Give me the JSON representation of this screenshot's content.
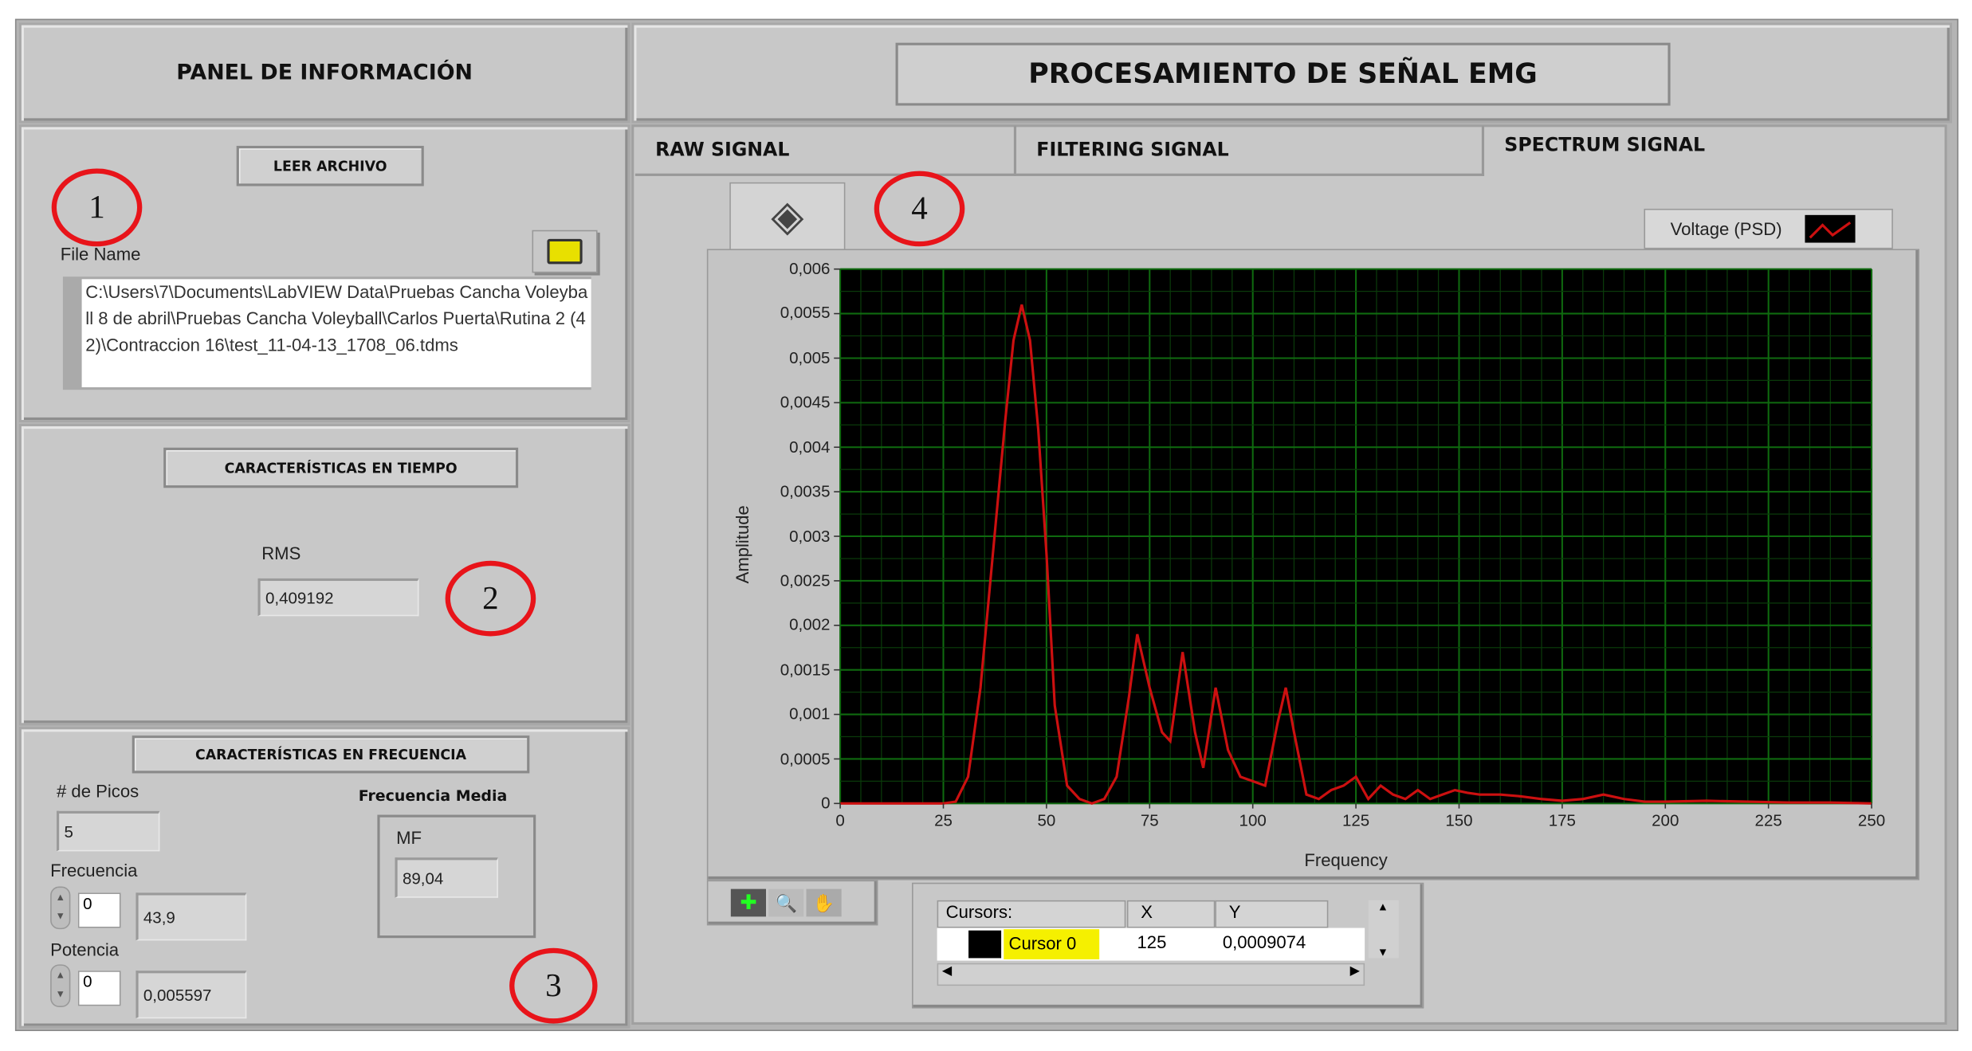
{
  "left_panel": {
    "title": "PANEL DE INFORMACIÓN",
    "read_file": {
      "button_label": "LEER ARCHIVO",
      "file_name_label": "File Name",
      "file_path": "C:\\Users\\7\\Documents\\LabVIEW Data\\Pruebas Cancha Voleyball 8 de abril\\Pruebas Cancha Voleyball\\Carlos Puerta\\Rutina 2 (42)\\Contraccion 16\\test_11-04-13_1708_06.tdms",
      "browse_icon": "folder-open-icon"
    },
    "time": {
      "header": "CARACTERÍSTICAS EN TIEMPO",
      "rms_label": "RMS",
      "rms_value": "0,409192"
    },
    "frequency": {
      "header": "CARACTERÍSTICAS EN FRECUENCIA",
      "peaks_label": "# de Picos",
      "peaks_value": "5",
      "freq_label": "Frecuencia",
      "freq_index": "0",
      "freq_value": "43,9",
      "power_label": "Potencia",
      "power_index": "0",
      "power_value": "0,005597",
      "mean_freq_header": "Frecuencia Media",
      "mf_label": "MF",
      "mf_value": "89,04"
    }
  },
  "annotations": [
    "1",
    "2",
    "3",
    "4"
  ],
  "right_panel": {
    "title": "PROCESAMIENTO DE SEÑAL EMG",
    "tabs": [
      {
        "label": "RAW SIGNAL",
        "active": false
      },
      {
        "label": "FILTERING SIGNAL",
        "active": false
      },
      {
        "label": "SPECTRUM SIGNAL",
        "active": true
      }
    ],
    "legend": {
      "label": "Voltage (PSD)",
      "color": "#cc1010"
    },
    "cursors": {
      "headers": [
        "Cursors:",
        "X",
        "Y"
      ],
      "rows": [
        {
          "name": "Cursor 0",
          "x": "125",
          "y": "0,0009074"
        }
      ]
    }
  },
  "chart_data": {
    "type": "line",
    "title": "",
    "xlabel": "Frequency",
    "ylabel": "Amplitude",
    "xlim": [
      0,
      250
    ],
    "ylim": [
      0,
      0.006
    ],
    "xticks": [
      "0",
      "25",
      "50",
      "75",
      "100",
      "125",
      "150",
      "175",
      "200",
      "225",
      "250"
    ],
    "yticks": [
      "0",
      "0,0005",
      "0,001",
      "0,0015",
      "0,002",
      "0,0025",
      "0,003",
      "0,0035",
      "0,004",
      "0,0045",
      "0,005",
      "0,0055",
      "0,006"
    ],
    "grid": true,
    "legend_position": "top-right",
    "series": [
      {
        "name": "Voltage (PSD)",
        "x": [
          0,
          25,
          28,
          31,
          34,
          37,
          40,
          42,
          44,
          46,
          48,
          50,
          52,
          55,
          58,
          61,
          64,
          67,
          70,
          72,
          75,
          78,
          80,
          83,
          86,
          88,
          91,
          94,
          97,
          100,
          103,
          106,
          108,
          110,
          113,
          116,
          119,
          122,
          125,
          128,
          131,
          134,
          137,
          140,
          143,
          146,
          149,
          152,
          155,
          160,
          165,
          170,
          175,
          180,
          185,
          190,
          195,
          200,
          210,
          220,
          230,
          240,
          250
        ],
        "y": [
          0,
          0,
          2e-05,
          0.0003,
          0.0013,
          0.0028,
          0.0043,
          0.0052,
          0.0056,
          0.0052,
          0.0042,
          0.0028,
          0.0011,
          0.0002,
          5e-05,
          0,
          5e-05,
          0.0003,
          0.0012,
          0.0019,
          0.0013,
          0.0008,
          0.0007,
          0.0017,
          0.0008,
          0.0004,
          0.0013,
          0.0006,
          0.0003,
          0.00025,
          0.0002,
          0.0009,
          0.0013,
          0.0008,
          0.0001,
          5e-05,
          0.00015,
          0.0002,
          0.0003,
          5e-05,
          0.0002,
          0.0001,
          5e-05,
          0.00015,
          5e-05,
          0.0001,
          0.00015,
          0.00012,
          0.0001,
          0.0001,
          8e-05,
          5e-05,
          3e-05,
          5e-05,
          0.0001,
          5e-05,
          2e-05,
          2e-05,
          3e-05,
          2e-05,
          1e-05,
          1e-05,
          0
        ]
      }
    ]
  }
}
